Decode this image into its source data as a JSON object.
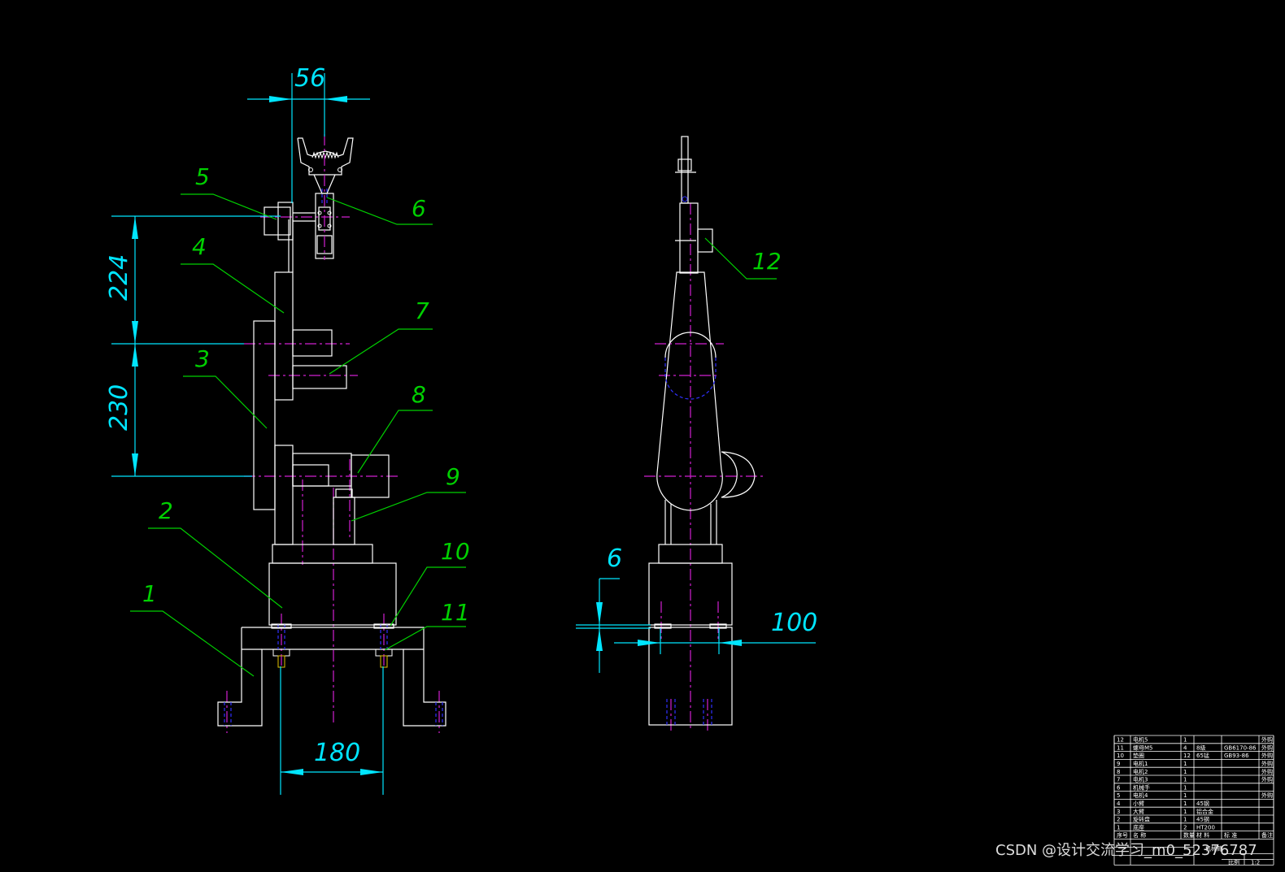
{
  "dimensions": {
    "d56": "56",
    "d224": "224",
    "d230": "230",
    "d180": "180",
    "d6": "6",
    "d100": "100"
  },
  "balloons": [
    "1",
    "2",
    "3",
    "4",
    "5",
    "6",
    "7",
    "8",
    "9",
    "10",
    "11",
    "12"
  ],
  "bom": {
    "rows": [
      {
        "no": "12",
        "name": "电机5",
        "qty": "1",
        "material": "",
        "std": "",
        "note": "外购"
      },
      {
        "no": "11",
        "name": "螺母M5",
        "qty": "4",
        "material": "8级",
        "std": "GB6170-86",
        "note": "外购"
      },
      {
        "no": "10",
        "name": "垫圈",
        "qty": "12",
        "material": "65锰",
        "std": "GB93-86",
        "note": "外购"
      },
      {
        "no": "9",
        "name": "电机1",
        "qty": "1",
        "material": "",
        "std": "",
        "note": "外购"
      },
      {
        "no": "8",
        "name": "电机2",
        "qty": "1",
        "material": "",
        "std": "",
        "note": "外购"
      },
      {
        "no": "7",
        "name": "电机3",
        "qty": "1",
        "material": "",
        "std": "",
        "note": "外购"
      },
      {
        "no": "6",
        "name": "机械手",
        "qty": "1",
        "material": "",
        "std": "",
        "note": ""
      },
      {
        "no": "5",
        "name": "电机4",
        "qty": "1",
        "material": "",
        "std": "",
        "note": "外购"
      },
      {
        "no": "4",
        "name": "小臂",
        "qty": "1",
        "material": "45钢",
        "std": "",
        "note": ""
      },
      {
        "no": "3",
        "name": "大臂",
        "qty": "1",
        "material": "铝合金",
        "std": "",
        "note": ""
      },
      {
        "no": "2",
        "name": "旋转盘",
        "qty": "1",
        "material": "45钢",
        "std": "",
        "note": ""
      },
      {
        "no": "1",
        "name": "底座",
        "qty": "2",
        "material": "HT200",
        "std": "",
        "note": ""
      }
    ],
    "header": {
      "no": "序号",
      "name": "名 称",
      "qty": "数量",
      "material": "材 料",
      "std": "标 准",
      "note": "备注"
    },
    "title": "机械臂",
    "scale_label": "比例",
    "scale": "1:2"
  },
  "watermark": "CSDN @设计交流学习_m0_52376787"
}
